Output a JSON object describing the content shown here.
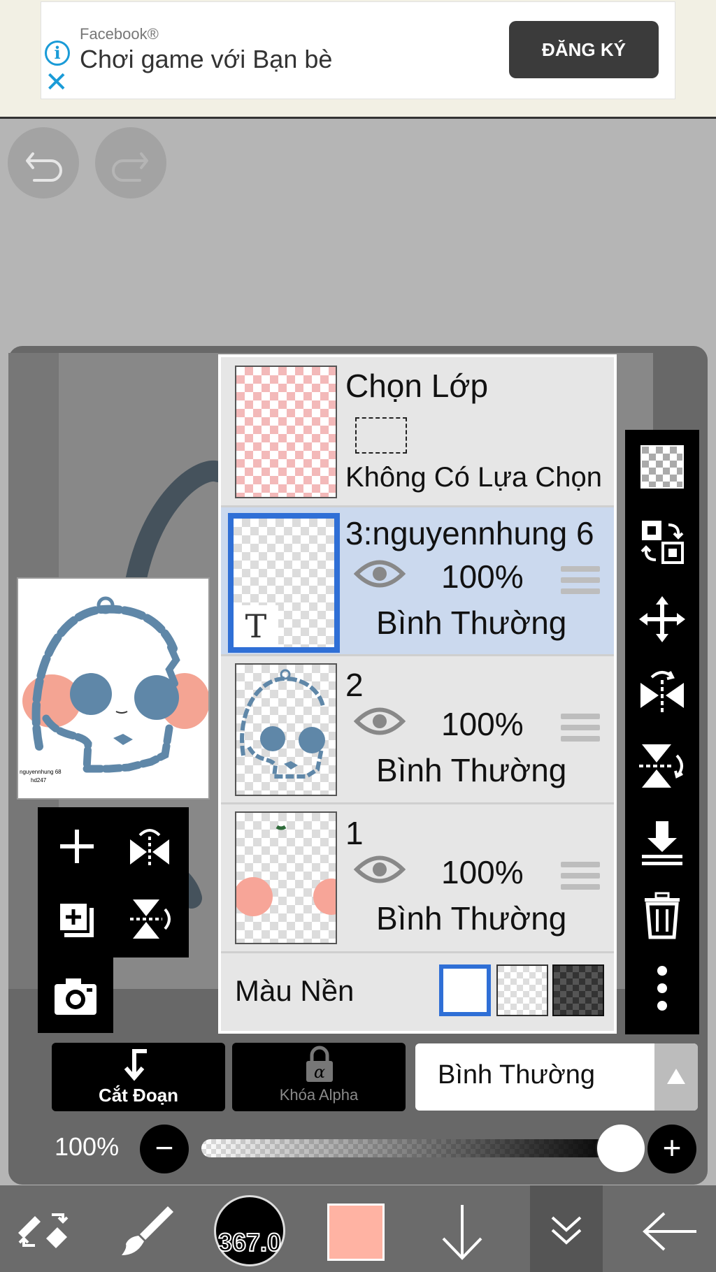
{
  "ad": {
    "source": "Facebook®",
    "title": "Chơi game với Bạn bè",
    "button": "ĐĂNG KÝ"
  },
  "selection_layer": {
    "title": "Chọn Lớp",
    "status": "Không Có Lựa Chọn"
  },
  "layers": [
    {
      "name": "3:nguyennhung 6",
      "opacity": "100%",
      "blend": "Bình Thường",
      "selected": true,
      "type_badge": "T"
    },
    {
      "name": "2",
      "opacity": "100%",
      "blend": "Bình Thường",
      "selected": false
    },
    {
      "name": "1",
      "opacity": "100%",
      "blend": "Bình Thường",
      "selected": false
    }
  ],
  "background": {
    "label": "Màu Nền",
    "options": [
      "white",
      "transparent",
      "dark-checker"
    ],
    "selected": "white"
  },
  "preview": {
    "caption_line1": "nguyennhung 68",
    "caption_line2": "hd247"
  },
  "bottom_controls": {
    "clipping_label": "Cắt Đoạn",
    "alpha_lock_label": "Khóa Alpha",
    "blend_mode": "Bình Thường",
    "opacity_label": "100%",
    "opacity_value": 1.0
  },
  "toolbar": {
    "brush_size": "367.0",
    "color": "#ffb3a3"
  },
  "colors": {
    "selected_border": "#2f6fd6",
    "selected_row": "#cbd9ee",
    "skull_blue": "#5f87a8",
    "blush_pink": "#f7a598"
  }
}
